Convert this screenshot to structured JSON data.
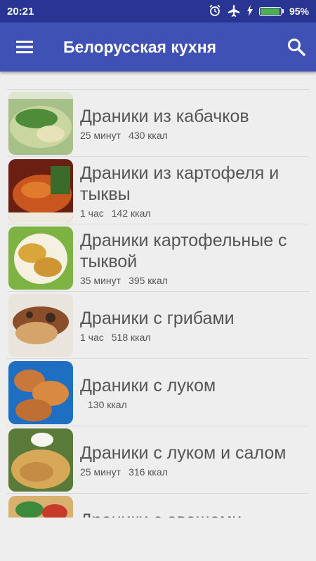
{
  "status": {
    "time": "20:21",
    "battery": "95%",
    "battery_level": 0.95,
    "accent": "#283593"
  },
  "appbar": {
    "title": "Белорусская кухня",
    "menu_icon": "hamburger-menu-icon",
    "search_icon": "search-icon",
    "color": "#3f51b5"
  },
  "recipes": [
    {
      "name": "Драники из кабачков",
      "time": "25 минут",
      "calories": "430 ккал"
    },
    {
      "name": "Драники из картофеля и тыквы",
      "time": "1 час",
      "calories": "142 ккал"
    },
    {
      "name": "Драники картофельные с тыквой",
      "time": "35 минут",
      "calories": "395 ккал"
    },
    {
      "name": "Драники с грибами",
      "time": "1 час",
      "calories": "518 ккал"
    },
    {
      "name": "Драники с луком",
      "time": "",
      "calories": "130 ккал"
    },
    {
      "name": "Драники с луком и салом",
      "time": "25 минут",
      "calories": "316 ккал"
    },
    {
      "name": "Драники с овощами",
      "time": "",
      "calories": ""
    }
  ]
}
